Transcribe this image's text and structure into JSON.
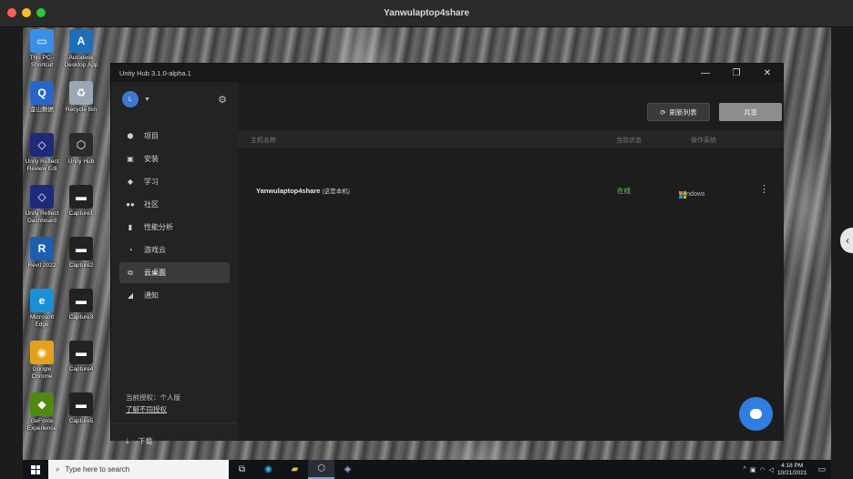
{
  "mac_window": {
    "title": "Yanwulaptop4share"
  },
  "desktop": {
    "icons": [
      {
        "label": "This PC -\nShortcut",
        "icon": "this-pc-icon",
        "color": "#3a8ee6",
        "glyph": "▭"
      },
      {
        "label": "Autodesk\nDesktop App",
        "icon": "autodesk-icon",
        "color": "#1e6fb8",
        "glyph": "A"
      },
      {
        "label": "金山数据",
        "icon": "kingsoft-icon",
        "color": "#2a66c9",
        "glyph": "Q"
      },
      {
        "label": "Recycle Bin",
        "icon": "recycle-bin-icon",
        "color": "#9aa7b4",
        "glyph": "♻"
      },
      {
        "label": "Unity Reflect\nReview Edi",
        "icon": "unity-reflect-icon",
        "color": "#1f2a7a",
        "glyph": "◇"
      },
      {
        "label": "Unity Hub",
        "icon": "unity-hub-icon",
        "color": "#2b2b2b",
        "glyph": "⬡"
      },
      {
        "label": "Unity Reflect\nDashboard",
        "icon": "unity-reflect-dashboard-icon",
        "color": "#1f2a7a",
        "glyph": "◇"
      },
      {
        "label": "Capture1",
        "icon": "capture-icon",
        "color": "#222",
        "glyph": "▬"
      },
      {
        "label": "Revit 2022",
        "icon": "revit-icon",
        "color": "#1b5fb0",
        "glyph": "R"
      },
      {
        "label": "Capture2",
        "icon": "capture-icon",
        "color": "#222",
        "glyph": "▬"
      },
      {
        "label": "Microsoft\nEdge",
        "icon": "edge-icon",
        "color": "#1a8fd6",
        "glyph": "e"
      },
      {
        "label": "Capture3",
        "icon": "capture-icon",
        "color": "#222",
        "glyph": "▬"
      },
      {
        "label": "Google\nChrome",
        "icon": "chrome-icon",
        "color": "#e4a11b",
        "glyph": "◉"
      },
      {
        "label": "Capture4",
        "icon": "capture-icon",
        "color": "#222",
        "glyph": "▬"
      },
      {
        "label": "GeForce\nExperience",
        "icon": "geforce-icon",
        "color": "#4f8a10",
        "glyph": "◆"
      },
      {
        "label": "Capture5",
        "icon": "capture-icon",
        "color": "#222",
        "glyph": "▬"
      }
    ]
  },
  "hub": {
    "title": "Unity Hub 3.1.0-alpha.1",
    "window_controls": {
      "minimize": "—",
      "restore": "❐",
      "close": "✕"
    },
    "account": {
      "initial": "L"
    },
    "nav": [
      {
        "label": "项目",
        "icon": "cube-icon",
        "glyph": "⬢",
        "active": false
      },
      {
        "label": "安装",
        "icon": "lock-icon",
        "glyph": "▣",
        "active": false
      },
      {
        "label": "学习",
        "icon": "graduation-cap-icon",
        "glyph": "◆",
        "active": false
      },
      {
        "label": "社区",
        "icon": "people-icon",
        "glyph": "●●",
        "active": false
      },
      {
        "label": "性能分析",
        "icon": "bar-chart-icon",
        "glyph": "▮",
        "active": false
      },
      {
        "label": "游戏云",
        "icon": "cloud-icon",
        "glyph": "◔",
        "active": false
      },
      {
        "label": "云桌面",
        "icon": "remote-desktop-icon",
        "glyph": "⧉",
        "active": true
      },
      {
        "label": "通知",
        "icon": "bell-icon",
        "glyph": "◢",
        "active": false
      }
    ],
    "license": {
      "current": "当前授权：个人版",
      "link": "了解不同授权"
    },
    "download_label": "下载",
    "toolbar": {
      "refresh_label": "刷新列表",
      "share_label": "共享"
    },
    "table": {
      "headers": {
        "host": "主机名称",
        "status": "当前状态",
        "os": "操作系统"
      },
      "rows": [
        {
          "host": "Yanwulaptop4share",
          "tag": "(这是本机)",
          "status": "在线",
          "os": "Windows"
        }
      ]
    },
    "colors": {
      "online": "#6cc96c",
      "chat": "#2f7ee2",
      "active_nav": "#3a3a3a"
    }
  },
  "taskbar": {
    "search_placeholder": "Type here to search",
    "time": "4:18 PM",
    "date": "10/21/2021"
  }
}
